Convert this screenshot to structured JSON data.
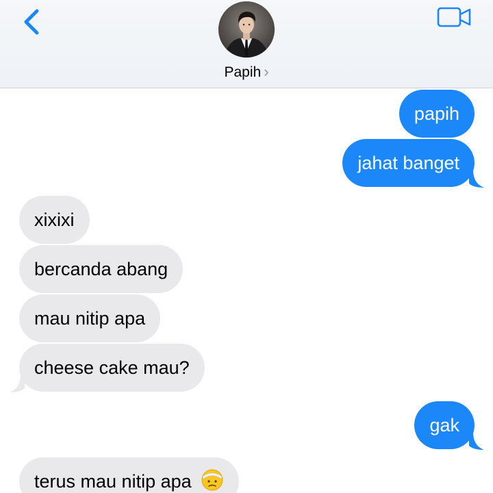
{
  "header": {
    "contact_name": "Papih",
    "chevron": "›",
    "back_icon": "chevron-left-icon",
    "video_icon": "video-camera-icon",
    "accent_color": "#1b87f8"
  },
  "messages": [
    {
      "direction": "sent",
      "text": "papih"
    },
    {
      "direction": "sent",
      "text": "jahat banget"
    },
    {
      "direction": "received",
      "text": "xixixi"
    },
    {
      "direction": "received",
      "text": "bercanda abang"
    },
    {
      "direction": "received",
      "text": "mau nitip apa"
    },
    {
      "direction": "received",
      "text": "cheese cake mau?"
    },
    {
      "direction": "sent",
      "text": "gak"
    },
    {
      "direction": "received",
      "text": "terus mau nitip apa",
      "emoji": "face-with-head-bandage"
    }
  ],
  "colors": {
    "sent_bubble": "#1b87f8",
    "received_bubble": "#e9e9eb"
  }
}
